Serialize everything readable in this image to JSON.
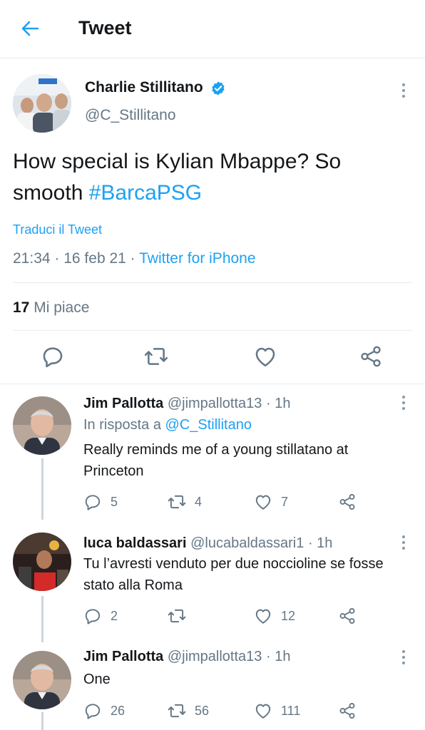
{
  "header": {
    "title": "Tweet"
  },
  "tweet": {
    "author_name": "Charlie Stillitano",
    "author_handle": "@C_Stillitano",
    "text_part1": "How special is Kylian Mbappe? So smooth ",
    "hashtag": "#BarcaPSG",
    "translate_label": "Traduci il Tweet",
    "time": "21:34",
    "date": "16 feb 21",
    "source": "Twitter for iPhone",
    "likes_count": "17",
    "likes_label": "Mi piace"
  },
  "replies": [
    {
      "name": "Jim Pallotta",
      "handle": "@jimpallotta13",
      "time": "1h",
      "reply_to_prefix": "In risposta a",
      "reply_to_handle": "@C_Stillitano",
      "text": "Really reminds me of a young stillatano at Princeton",
      "reply_count": "5",
      "retweet_count": "4",
      "like_count": "7"
    },
    {
      "name": "luca baldassari",
      "handle": "@lucabaldassari1",
      "time": "1h",
      "text": "Tu l’avresti venduto per due noccioline se fosse stato alla Roma",
      "reply_count": "2",
      "retweet_count": "",
      "like_count": "12"
    },
    {
      "name": "Jim Pallotta",
      "handle": "@jimpallotta13",
      "time": "1h",
      "text": "One",
      "reply_count": "26",
      "retweet_count": "56",
      "like_count": "111"
    }
  ],
  "colors": {
    "accent": "#1da1f2",
    "secondary_text": "#657786",
    "primary_text": "#14171a",
    "divider": "#e6ecf0"
  },
  "icons": [
    "back-arrow-icon",
    "verified-icon",
    "more-vertical-icon",
    "reply-icon",
    "retweet-icon",
    "like-heart-icon",
    "share-icon"
  ]
}
